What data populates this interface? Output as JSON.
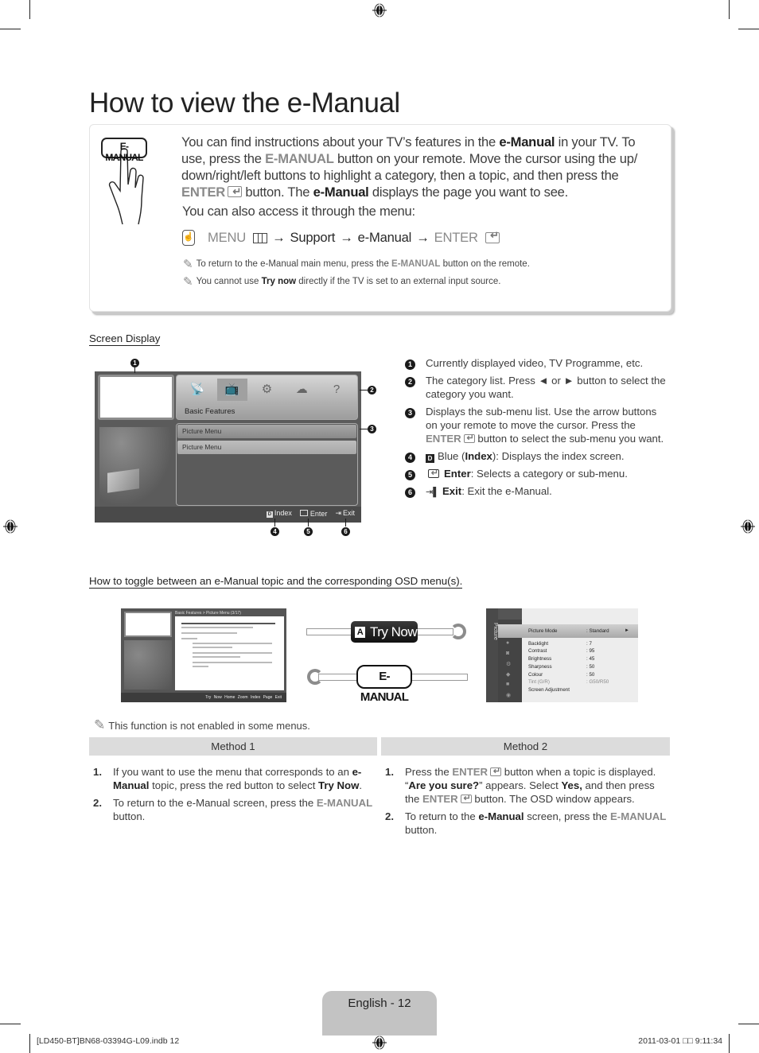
{
  "page": {
    "title": "How to view the e-Manual",
    "page_label": "English - 12",
    "footer_file": "[LD450-BT]BN68-03394G-L09.indb   12",
    "footer_timestamp": "2011-03-01   □□ 9:11:34"
  },
  "intro": {
    "remote_button_label": "E-MANUAL",
    "paragraph": {
      "t1": "You can find instructions about your TV’s features in the ",
      "b1": "e-Manual",
      "t2": " in your TV. To use, press the ",
      "g1": "E-MANUAL",
      "t3": " button on your remote. Move the cursor using the up/ down/right/left buttons to highlight a category, then a topic, and then press the ",
      "g2": "ENTER",
      "t4": " button. The ",
      "b2": "e-Manual",
      "t5": " displays the page you want to see."
    },
    "access_text": "You can also access it through the menu:",
    "menu_path": {
      "menu": "MENU",
      "arrow": "→",
      "support": "Support",
      "emanual": "e-Manual",
      "enter": "ENTER"
    },
    "notes": [
      {
        "t1": "To return to the e-Manual main menu, press the ",
        "g": "E-MANUAL",
        "t2": " button on the remote."
      },
      {
        "t1": "You cannot use ",
        "b": "Try now",
        "t2": " directly if the TV is set to an external input source."
      }
    ]
  },
  "screen_display": {
    "heading": "Screen Display",
    "category_label": "Basic Features",
    "submenu_items": [
      "Picture Menu",
      "Picture Menu"
    ],
    "footer_buttons": {
      "index": "Index",
      "enter": "Enter",
      "exit": "Exit",
      "index_key": "D"
    },
    "callouts": [
      "1",
      "2",
      "3",
      "4",
      "5",
      "6"
    ],
    "legend": [
      {
        "num": "1",
        "text": "Currently displayed video, TV Programme, etc."
      },
      {
        "num": "2",
        "text": "The category list. Press ◄ or ► button to select the category you want."
      },
      {
        "num": "3",
        "t1": "Displays the sub-menu list. Use the arrow buttons on your remote to move the cursor. Press the ",
        "g": "ENTER",
        "t2": " button to select the sub-menu you want."
      },
      {
        "num": "4",
        "key": "D",
        "t1": "Blue (",
        "b": "Index",
        "t2": "): Displays the index screen."
      },
      {
        "num": "5",
        "b": "Enter",
        "t2": ": Selects a category or sub-menu."
      },
      {
        "num": "6",
        "b": "Exit",
        "t2": ": Exit the e-Manual."
      }
    ]
  },
  "toggle": {
    "heading": "How to toggle between an e-Manual topic and the corresponding OSD menu(s).",
    "emanual_screen": {
      "header": "Basic Features > Picture Menu (3/17)",
      "footer": "Try Now  Home  Zoom  Index  Page  Exit"
    },
    "try_now_key": "A",
    "try_now_label": "Try Now",
    "emanual_button_label": "E-MANUAL",
    "osd": {
      "side_label": "Picture",
      "rows": [
        {
          "key": "Picture Mode",
          "value": ": Standard",
          "selected": true
        },
        {
          "key": "Backlight",
          "value": ": 7"
        },
        {
          "key": "Contrast",
          "value": ": 95"
        },
        {
          "key": "Brightness",
          "value": ": 45"
        },
        {
          "key": "Sharpness",
          "value": ": 50"
        },
        {
          "key": "Colour",
          "value": ": 50"
        },
        {
          "key": "Tint (G/R)",
          "value": ": G50/R50",
          "dim": true
        },
        {
          "key": "Screen Adjustment",
          "value": ""
        }
      ]
    },
    "note": "This function is not enabled in some menus."
  },
  "methods": {
    "method1": {
      "header": "Method 1",
      "items": [
        {
          "n": "1.",
          "t1": "If you want to use the menu that corresponds to an ",
          "b1": "e-Manual",
          "t2": " topic, press the red button to select ",
          "b2": "Try Now",
          "t3": "."
        },
        {
          "n": "2.",
          "t1": "To return to the e-Manual screen, press the ",
          "g": "E-MANUAL",
          "t2": " button."
        }
      ]
    },
    "method2": {
      "header": "Method 2",
      "items": [
        {
          "n": "1.",
          "t1": "Press the ",
          "g1": "ENTER",
          "t2": " button when a topic is displayed. “",
          "b1": "Are you sure?",
          "t3": "” appears. Select ",
          "b2": "Yes,",
          "t4": " and then press the ",
          "g2": "ENTER",
          "t5": " button. The OSD window appears."
        },
        {
          "n": "2.",
          "t1": "To return to the ",
          "b1": "e-Manual",
          "t2": " screen, press the ",
          "g": "E-MANUAL",
          "t3": " button."
        }
      ]
    }
  }
}
